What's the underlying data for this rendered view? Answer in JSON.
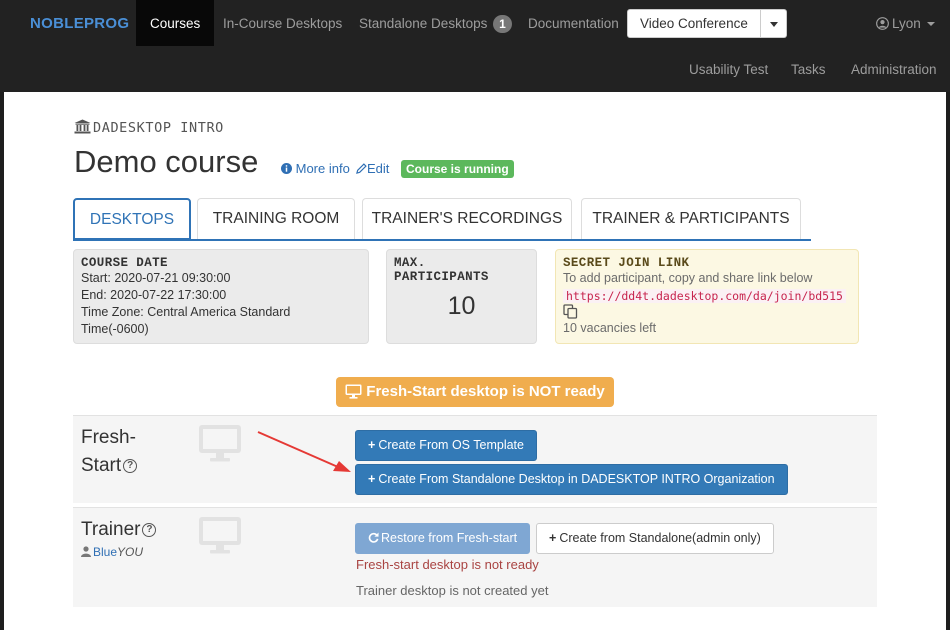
{
  "nav": {
    "brand": "NOBLEPROG",
    "items": [
      {
        "label": "Courses"
      },
      {
        "label": "In-Course Desktops"
      },
      {
        "label": "Standalone Desktops",
        "badge": "1"
      },
      {
        "label": "Documentation"
      }
    ],
    "video_conference": "Video Conference",
    "user": "Lyon",
    "second_row": [
      "Usability Test",
      "Tasks",
      "Administration"
    ]
  },
  "course": {
    "organization": "DADESKTOP INTRO",
    "title": "Demo course",
    "more_info": "More info",
    "edit": "Edit",
    "status": "Course is running"
  },
  "tabs": [
    "DESKTOPS",
    "TRAINING ROOM",
    "TRAINER'S RECORDINGS",
    "TRAINER & PARTICIPANTS"
  ],
  "course_date": {
    "title": "COURSE DATE",
    "start": "Start: 2020-07-21 09:30:00",
    "end": "End: 2020-07-22 17:30:00",
    "tz1": "Time Zone: Central America Standard",
    "tz2": "Time(-0600)"
  },
  "max_participants": {
    "title1": "MAX.",
    "title2": "PARTICIPANTS",
    "value": "10"
  },
  "join_link": {
    "title": "SECRET JOIN LINK",
    "desc": "To add participant, copy and share link below",
    "url": "https://dd4t.dadesktop.com/da/join/bd515",
    "vacancies": "10 vacancies left"
  },
  "banner": "Fresh-Start desktop is NOT ready",
  "fresh_start": {
    "label1": "Fresh-",
    "label2": "Start",
    "btn_os": "Create From OS Template",
    "btn_standalone": "Create From Standalone Desktop in DADESKTOP INTRO Organization"
  },
  "trainer": {
    "label": "Trainer",
    "user_first": "Blue",
    "user_last": "YOU",
    "btn_restore": "Restore from Fresh-start",
    "btn_create": "Create from Standalone(admin only)",
    "status_error": "Fresh-start desktop is not ready",
    "status_muted": "Trainer desktop is not created yet"
  },
  "colors": {
    "primary": "#337ab7",
    "success": "#5cb85c",
    "warning": "#f0ad4e",
    "danger": "#a94442",
    "annotation_arrow": "#e53935"
  }
}
